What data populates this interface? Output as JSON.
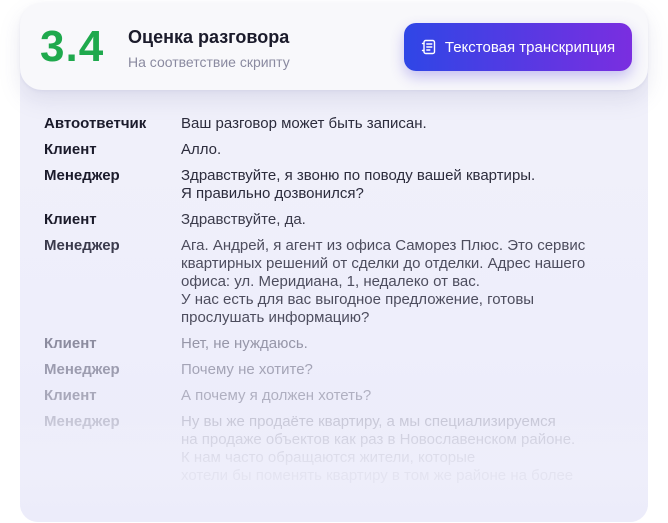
{
  "header": {
    "score": "3.4",
    "title": "Оценка разговора",
    "subtitle": "На соответствие скрипту",
    "button_label": "Текстовая транскрипция",
    "button_icon": "transcript-icon"
  },
  "colors": {
    "score": "#1fa94d",
    "button_gradient_start": "#2f46e6",
    "button_gradient_end": "#7a2ee0"
  },
  "transcript": [
    {
      "speaker": "Автоответчик",
      "text": "Ваш разговор может быть записан."
    },
    {
      "speaker": "Клиент",
      "text": "Алло."
    },
    {
      "speaker": "Менеджер",
      "text": "Здравствуйте, я звоню по поводу вашей квартиры.\nЯ правильно дозвонился?"
    },
    {
      "speaker": "Клиент",
      "text": "Здравствуйте, да."
    },
    {
      "speaker": "Менеджер",
      "text": "Ага. Андрей, я агент из офиса Саморез Плюс. Это сервис\nквартирных решений от сделки до отделки. Адрес нашего\nофиса: ул. Меридиана, 1, недалеко от вас.\nУ нас есть для вас выгодное предложение, готовы\nпрослушать информацию?"
    },
    {
      "speaker": "Клиент",
      "text": "Нет, не нуждаюсь."
    },
    {
      "speaker": "Менеджер",
      "text": "Почему не хотите?"
    },
    {
      "speaker": "Клиент",
      "text": "А почему я должен хотеть?"
    },
    {
      "speaker": "Менеджер",
      "text": "Ну вы же продаёте квартиру, а мы специализируемся\nна продаже объектов как раз в Новославенском районе.\nК нам часто обращаются жители, которые\nхотели бы поменять квартиру в том же районе на более"
    }
  ]
}
